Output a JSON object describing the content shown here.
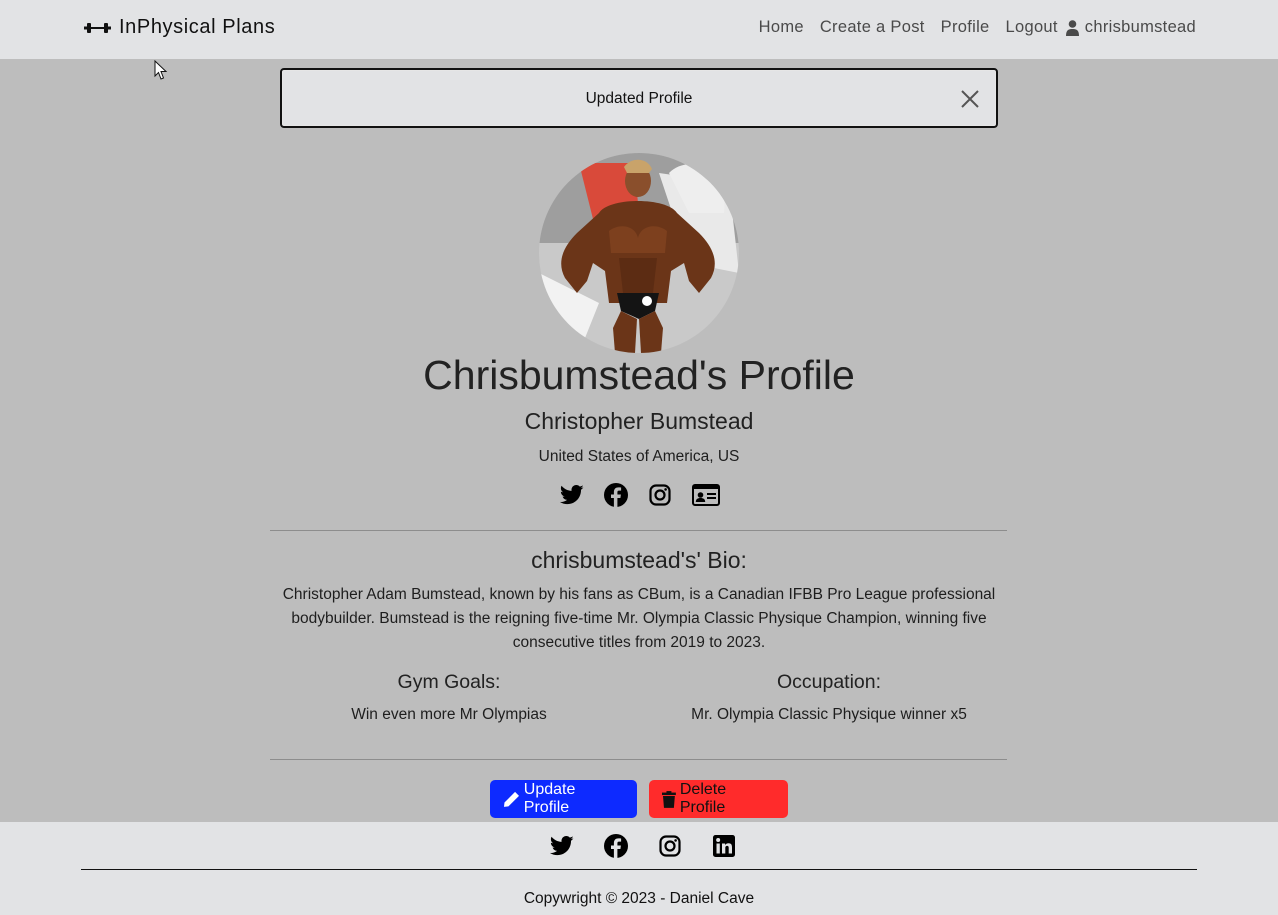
{
  "navbar": {
    "brand": "InPhysical Plans",
    "brand_icon": "dumbbell-icon",
    "links": [
      "Home",
      "Create a Post",
      "Profile",
      "Logout"
    ],
    "user_icon": "user-icon",
    "username": "chrisbumstead"
  },
  "alert": {
    "message": "Updated Profile",
    "close_icon": "close-icon"
  },
  "profile": {
    "avatar": "profile-photo",
    "title": "Chrisbumstead's Profile",
    "full_name": "Christopher Bumstead",
    "location": "United States of America, US",
    "social_icons": [
      "twitter-icon",
      "facebook-icon",
      "instagram-icon",
      "id-card-icon"
    ],
    "bio_title": "chrisbumstead's' Bio:",
    "bio": "Christopher Adam Bumstead, known by his fans as CBum, is a Canadian IFBB Pro League professional bodybuilder. Bumstead is the reigning five-time Mr. Olympia Classic Physique Champion, winning five consecutive titles from 2019 to 2023.",
    "gym_goals_label": "Gym Goals:",
    "gym_goals": "Win even more Mr Olympias",
    "occupation_label": "Occupation:",
    "occupation": "Mr. Olympia Classic Physique winner x5"
  },
  "actions": {
    "update_label": "Update Profile",
    "update_icon": "pencil-icon",
    "update_color": "#0d2aff",
    "delete_label": "Delete Profile",
    "delete_icon": "trash-icon",
    "delete_color": "#ff2b2b"
  },
  "footer": {
    "social_icons": [
      "twitter-icon",
      "facebook-icon",
      "instagram-icon",
      "linkedin-icon"
    ],
    "copyright": "Copywright © 2023 - Daniel Cave"
  }
}
